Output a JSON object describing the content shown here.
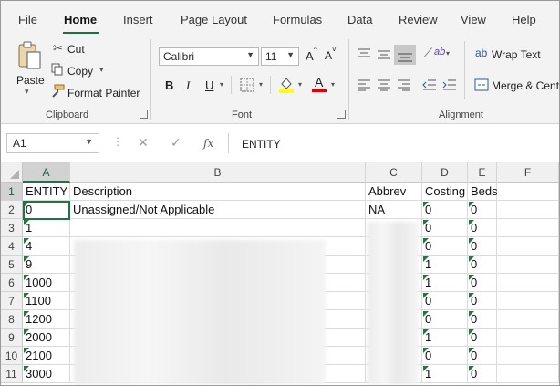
{
  "ribbon_tabs": [
    "File",
    "Home",
    "Insert",
    "Page Layout",
    "Formulas",
    "Data",
    "Review",
    "View",
    "Help"
  ],
  "active_tab": "Home",
  "clipboard": {
    "paste": "Paste",
    "cut": "Cut",
    "copy": "Copy",
    "format_painter": "Format Painter",
    "label": "Clipboard"
  },
  "font": {
    "name": "Calibri",
    "size": "11",
    "bold": "B",
    "italic": "I",
    "underline": "U",
    "grow": "A",
    "shrink": "A",
    "label": "Font",
    "fill_color": "#ffff00",
    "font_color": "#e00000"
  },
  "alignment": {
    "wrap_text": "Wrap Text",
    "merge_center": "Merge & Center",
    "label": "Alignment"
  },
  "formula_bar": {
    "name_box": "A1",
    "fx": "fx",
    "formula": "ENTITY"
  },
  "columns": [
    "A",
    "B",
    "C",
    "D",
    "E",
    "F"
  ],
  "selected_column": "A",
  "rows": [
    {
      "num": "1",
      "A": "ENTITY",
      "B": "Description",
      "C": "Abbrev",
      "D": "Costing",
      "E": "Beds"
    },
    {
      "num": "2",
      "A": "0",
      "B": "Unassigned/Not Applicable",
      "C": "NA",
      "D": "0",
      "E": "0"
    },
    {
      "num": "3",
      "A": "1",
      "B": "",
      "C": "",
      "D": "0",
      "E": "0"
    },
    {
      "num": "4",
      "A": "4",
      "B": "",
      "C": "",
      "D": "0",
      "E": "0"
    },
    {
      "num": "5",
      "A": "9",
      "B": "",
      "C": "",
      "D": "1",
      "E": "0"
    },
    {
      "num": "6",
      "A": "1000",
      "B": "",
      "C": "",
      "D": "1",
      "E": "0"
    },
    {
      "num": "7",
      "A": "1100",
      "B": "",
      "C": "",
      "D": "0",
      "E": "0"
    },
    {
      "num": "8",
      "A": "1200",
      "B": "",
      "C": "",
      "D": "0",
      "E": "0"
    },
    {
      "num": "9",
      "A": "2000",
      "B": "",
      "C": "",
      "D": "1",
      "E": "0"
    },
    {
      "num": "10",
      "A": "2100",
      "B": "",
      "C": "",
      "D": "0",
      "E": "0"
    },
    {
      "num": "11",
      "A": "3000",
      "B": "",
      "C": "",
      "D": "1",
      "E": "0"
    }
  ],
  "accent_color": "#217346"
}
